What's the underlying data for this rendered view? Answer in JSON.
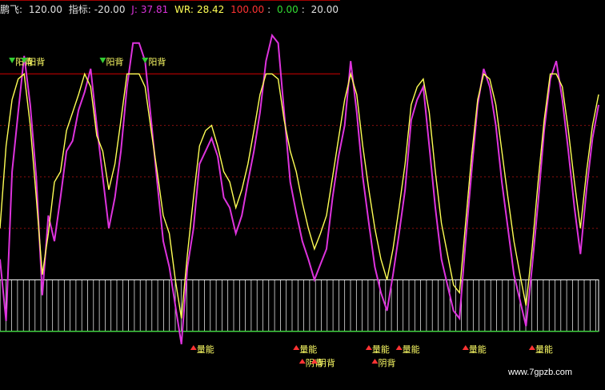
{
  "header": {
    "name": "鹏飞",
    "top_value": "120.00",
    "indicator_label": "指标:",
    "indicator_value": "-20.00",
    "j_label": "J:",
    "j_value": "37.81",
    "wr_label": "WR:",
    "wr_value": "28.42",
    "ref1": "100.00",
    "ref2": "0.00",
    "ref3": "20.00",
    "sep": ":"
  },
  "watermark": "www.7gpzb.com",
  "colors": {
    "background": "#000000",
    "yellow_line": "#ffff55",
    "magenta_line": "#dd33dd",
    "red_ref": "#aa0000",
    "green_ref": "#33dd33",
    "grid_dotted": "#8a1010",
    "band_fill": "#ffffff",
    "green_signal": "#33cc33",
    "red_signal": "#ff3333",
    "signal_text": "#ffff66"
  },
  "chart_data": {
    "type": "line",
    "ylim": [
      -20,
      120
    ],
    "reference_levels": [
      100,
      0
    ],
    "band": {
      "from": 0,
      "to": 20
    },
    "x": [
      0,
      1,
      2,
      3,
      4,
      5,
      6,
      7,
      8,
      9,
      10,
      11,
      12,
      13,
      14,
      15,
      16,
      17,
      18,
      19,
      20,
      21,
      22,
      23,
      24,
      25,
      26,
      27,
      28,
      29,
      30,
      31,
      32,
      33,
      34,
      35,
      36,
      37,
      38,
      39,
      40,
      41,
      42,
      43,
      44,
      45,
      46,
      47,
      48,
      49,
      50,
      51,
      52,
      53,
      54,
      55,
      56,
      57,
      58,
      59,
      60,
      61,
      62,
      63,
      64,
      65,
      66,
      67,
      68,
      69,
      70,
      71,
      72,
      73,
      74,
      75,
      76,
      77,
      78,
      79,
      80,
      81,
      82,
      83,
      84,
      85,
      86,
      87,
      88,
      89,
      90,
      91,
      92,
      93,
      94,
      95,
      96,
      97,
      98,
      99
    ],
    "series": [
      {
        "name": "J",
        "color": "#dd33dd",
        "values": [
          28,
          4,
          62,
          85,
          107,
          88,
          60,
          14,
          45,
          35,
          52,
          70,
          74,
          86,
          93,
          102,
          80,
          60,
          40,
          52,
          70,
          95,
          112,
          112,
          105,
          82,
          58,
          35,
          25,
          10,
          -5,
          25,
          40,
          65,
          70,
          75,
          68,
          52,
          48,
          38,
          45,
          58,
          70,
          85,
          105,
          115,
          112,
          85,
          58,
          46,
          35,
          28,
          20,
          26,
          32,
          52,
          68,
          80,
          105,
          85,
          60,
          42,
          25,
          15,
          8,
          22,
          38,
          55,
          82,
          90,
          95,
          72,
          48,
          28,
          18,
          8,
          5,
          35,
          62,
          88,
          102,
          95,
          80,
          58,
          40,
          22,
          12,
          2,
          25,
          50,
          78,
          98,
          105,
          90,
          70,
          48,
          30,
          55,
          75,
          88
        ]
      },
      {
        "name": "WR",
        "color": "#ffff55",
        "values": [
          40,
          72,
          90,
          98,
          100,
          80,
          52,
          22,
          38,
          58,
          62,
          78,
          85,
          92,
          100,
          95,
          76,
          70,
          55,
          65,
          82,
          100,
          100,
          100,
          95,
          78,
          62,
          45,
          38,
          20,
          5,
          30,
          52,
          72,
          78,
          80,
          72,
          62,
          58,
          48,
          55,
          65,
          78,
          92,
          100,
          100,
          98,
          82,
          70,
          62,
          50,
          40,
          32,
          38,
          45,
          60,
          75,
          90,
          100,
          92,
          72,
          55,
          40,
          28,
          20,
          32,
          48,
          65,
          88,
          95,
          98,
          85,
          62,
          42,
          30,
          18,
          15,
          42,
          68,
          90,
          100,
          98,
          88,
          70,
          52,
          35,
          22,
          10,
          32,
          58,
          82,
          100,
          100,
          95,
          78,
          58,
          40,
          62,
          80,
          92
        ]
      }
    ],
    "signals": [
      {
        "text": "阳背",
        "x": 2,
        "kind": "top"
      },
      {
        "text": "阳背",
        "x": 4,
        "kind": "top"
      },
      {
        "text": "阳背",
        "x": 17,
        "kind": "top"
      },
      {
        "text": "阳背",
        "x": 24,
        "kind": "top"
      },
      {
        "text": "量能",
        "x": 32,
        "kind": "bottom"
      },
      {
        "text": "量能",
        "x": 49,
        "kind": "bottom"
      },
      {
        "text": "阴背",
        "x": 50,
        "kind": "bottom2"
      },
      {
        "text": "阴背",
        "x": 52,
        "kind": "bottom2"
      },
      {
        "text": "量能",
        "x": 61,
        "kind": "bottom"
      },
      {
        "text": "阴背",
        "x": 62,
        "kind": "bottom2"
      },
      {
        "text": "量能",
        "x": 66,
        "kind": "bottom"
      },
      {
        "text": "量能",
        "x": 77,
        "kind": "bottom"
      },
      {
        "text": "量能",
        "x": 88,
        "kind": "bottom"
      }
    ]
  }
}
